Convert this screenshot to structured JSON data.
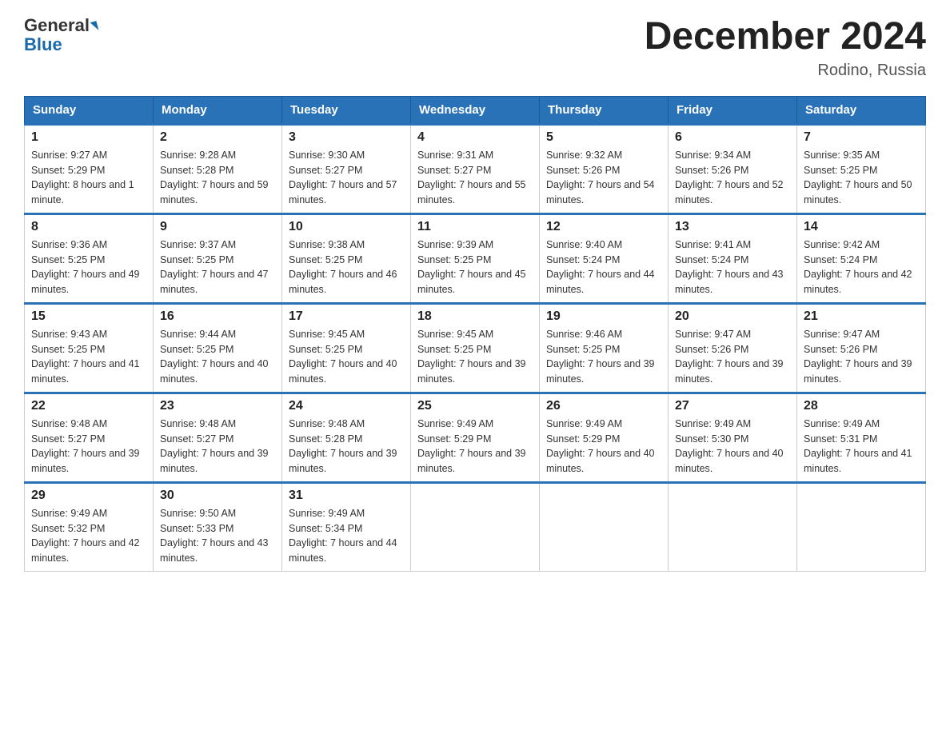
{
  "header": {
    "logo_line1": "General",
    "logo_line2": "Blue",
    "title": "December 2024",
    "subtitle": "Rodino, Russia"
  },
  "days_of_week": [
    "Sunday",
    "Monday",
    "Tuesday",
    "Wednesday",
    "Thursday",
    "Friday",
    "Saturday"
  ],
  "weeks": [
    [
      {
        "day": "1",
        "sunrise": "9:27 AM",
        "sunset": "5:29 PM",
        "daylight": "8 hours and 1 minute."
      },
      {
        "day": "2",
        "sunrise": "9:28 AM",
        "sunset": "5:28 PM",
        "daylight": "7 hours and 59 minutes."
      },
      {
        "day": "3",
        "sunrise": "9:30 AM",
        "sunset": "5:27 PM",
        "daylight": "7 hours and 57 minutes."
      },
      {
        "day": "4",
        "sunrise": "9:31 AM",
        "sunset": "5:27 PM",
        "daylight": "7 hours and 55 minutes."
      },
      {
        "day": "5",
        "sunrise": "9:32 AM",
        "sunset": "5:26 PM",
        "daylight": "7 hours and 54 minutes."
      },
      {
        "day": "6",
        "sunrise": "9:34 AM",
        "sunset": "5:26 PM",
        "daylight": "7 hours and 52 minutes."
      },
      {
        "day": "7",
        "sunrise": "9:35 AM",
        "sunset": "5:25 PM",
        "daylight": "7 hours and 50 minutes."
      }
    ],
    [
      {
        "day": "8",
        "sunrise": "9:36 AM",
        "sunset": "5:25 PM",
        "daylight": "7 hours and 49 minutes."
      },
      {
        "day": "9",
        "sunrise": "9:37 AM",
        "sunset": "5:25 PM",
        "daylight": "7 hours and 47 minutes."
      },
      {
        "day": "10",
        "sunrise": "9:38 AM",
        "sunset": "5:25 PM",
        "daylight": "7 hours and 46 minutes."
      },
      {
        "day": "11",
        "sunrise": "9:39 AM",
        "sunset": "5:25 PM",
        "daylight": "7 hours and 45 minutes."
      },
      {
        "day": "12",
        "sunrise": "9:40 AM",
        "sunset": "5:24 PM",
        "daylight": "7 hours and 44 minutes."
      },
      {
        "day": "13",
        "sunrise": "9:41 AM",
        "sunset": "5:24 PM",
        "daylight": "7 hours and 43 minutes."
      },
      {
        "day": "14",
        "sunrise": "9:42 AM",
        "sunset": "5:24 PM",
        "daylight": "7 hours and 42 minutes."
      }
    ],
    [
      {
        "day": "15",
        "sunrise": "9:43 AM",
        "sunset": "5:25 PM",
        "daylight": "7 hours and 41 minutes."
      },
      {
        "day": "16",
        "sunrise": "9:44 AM",
        "sunset": "5:25 PM",
        "daylight": "7 hours and 40 minutes."
      },
      {
        "day": "17",
        "sunrise": "9:45 AM",
        "sunset": "5:25 PM",
        "daylight": "7 hours and 40 minutes."
      },
      {
        "day": "18",
        "sunrise": "9:45 AM",
        "sunset": "5:25 PM",
        "daylight": "7 hours and 39 minutes."
      },
      {
        "day": "19",
        "sunrise": "9:46 AM",
        "sunset": "5:25 PM",
        "daylight": "7 hours and 39 minutes."
      },
      {
        "day": "20",
        "sunrise": "9:47 AM",
        "sunset": "5:26 PM",
        "daylight": "7 hours and 39 minutes."
      },
      {
        "day": "21",
        "sunrise": "9:47 AM",
        "sunset": "5:26 PM",
        "daylight": "7 hours and 39 minutes."
      }
    ],
    [
      {
        "day": "22",
        "sunrise": "9:48 AM",
        "sunset": "5:27 PM",
        "daylight": "7 hours and 39 minutes."
      },
      {
        "day": "23",
        "sunrise": "9:48 AM",
        "sunset": "5:27 PM",
        "daylight": "7 hours and 39 minutes."
      },
      {
        "day": "24",
        "sunrise": "9:48 AM",
        "sunset": "5:28 PM",
        "daylight": "7 hours and 39 minutes."
      },
      {
        "day": "25",
        "sunrise": "9:49 AM",
        "sunset": "5:29 PM",
        "daylight": "7 hours and 39 minutes."
      },
      {
        "day": "26",
        "sunrise": "9:49 AM",
        "sunset": "5:29 PM",
        "daylight": "7 hours and 40 minutes."
      },
      {
        "day": "27",
        "sunrise": "9:49 AM",
        "sunset": "5:30 PM",
        "daylight": "7 hours and 40 minutes."
      },
      {
        "day": "28",
        "sunrise": "9:49 AM",
        "sunset": "5:31 PM",
        "daylight": "7 hours and 41 minutes."
      }
    ],
    [
      {
        "day": "29",
        "sunrise": "9:49 AM",
        "sunset": "5:32 PM",
        "daylight": "7 hours and 42 minutes."
      },
      {
        "day": "30",
        "sunrise": "9:50 AM",
        "sunset": "5:33 PM",
        "daylight": "7 hours and 43 minutes."
      },
      {
        "day": "31",
        "sunrise": "9:49 AM",
        "sunset": "5:34 PM",
        "daylight": "7 hours and 44 minutes."
      },
      null,
      null,
      null,
      null
    ]
  ]
}
